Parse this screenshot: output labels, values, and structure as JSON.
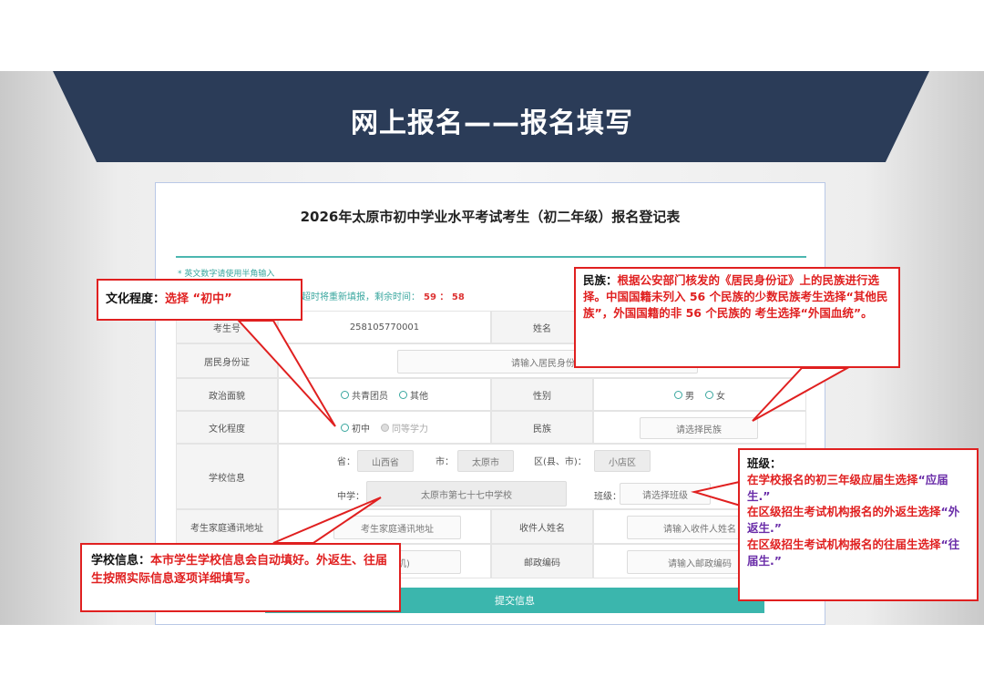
{
  "slide": {
    "title": "网上报名——报名填写"
  },
  "form": {
    "title": "2026年太原市初中学业水平考试考生（初二年级）报名登记表",
    "note": "* 英文数字请使用半角输入",
    "timer_text": "超时将重新填报，剩余时间：",
    "timer_value": "59 ： 58",
    "labels": {
      "exam_no": "考生号",
      "name": "姓名",
      "id_card": "居民身份证",
      "politics": "政治面貌",
      "gender": "性别",
      "education": "文化程度",
      "ethnicity": "民族",
      "school_info": "学校信息",
      "address": "考生家庭通讯地址",
      "recipient": "收件人姓名",
      "postcode": "邮政编码"
    },
    "values": {
      "exam_no": "258105770001",
      "id_card_placeholder": "请输入居民身份证",
      "politics_options": [
        "共青团员",
        "其他"
      ],
      "gender_options": [
        "男",
        "女"
      ],
      "education_options": [
        "初中",
        "同等学力"
      ],
      "ethnicity_placeholder": "请选择民族",
      "province_label": "省：",
      "province": "山西省",
      "city_label": "市：",
      "city": "太原市",
      "district_label": "区(县、市)：",
      "district": "小店区",
      "school_label": "中学：",
      "school": "太原市第七十七中学校",
      "class_label": "班级：",
      "class_placeholder": "请选择班级",
      "address_placeholder": "考生家庭通讯地址",
      "phone_placeholder": "(手机)",
      "recipient_placeholder": "请输入收件人姓名",
      "postcode_placeholder": "请输入邮政编码"
    },
    "submit_label": "提交信息"
  },
  "callouts": {
    "education": {
      "head": "文化程度：",
      "body": "选择 “初中”"
    },
    "ethnicity": {
      "head": "民族：",
      "body": "根据公安部门核发的《居民身份证》上的民族进行选择。中国国籍未列入 56 个民族的少数民族考生选择“其他民族”，外国国籍的非 56 个民族的 考生选择“外国血统”。"
    },
    "class": {
      "head": "班级：",
      "line1": "在学校报名的初三年级应届生选择",
      "line1_em": "“应届生.”",
      "line2": "在区级招生考试机构报名的外返生选择",
      "line2_em": "“外返生.”",
      "line3": "在区级招生考试机构报名的往届生选择",
      "line3_em": "“往届生.”"
    },
    "school": {
      "head": "学校信息：",
      "body": "本市学生学校信息会自动填好。外返生、往届生按照实际信息逐项详细填写。"
    }
  },
  "colors": {
    "banner": "#2b3c58",
    "accent": "#3bb6ad",
    "callout_border": "#e02020",
    "emphasis": "#6a2da8"
  }
}
